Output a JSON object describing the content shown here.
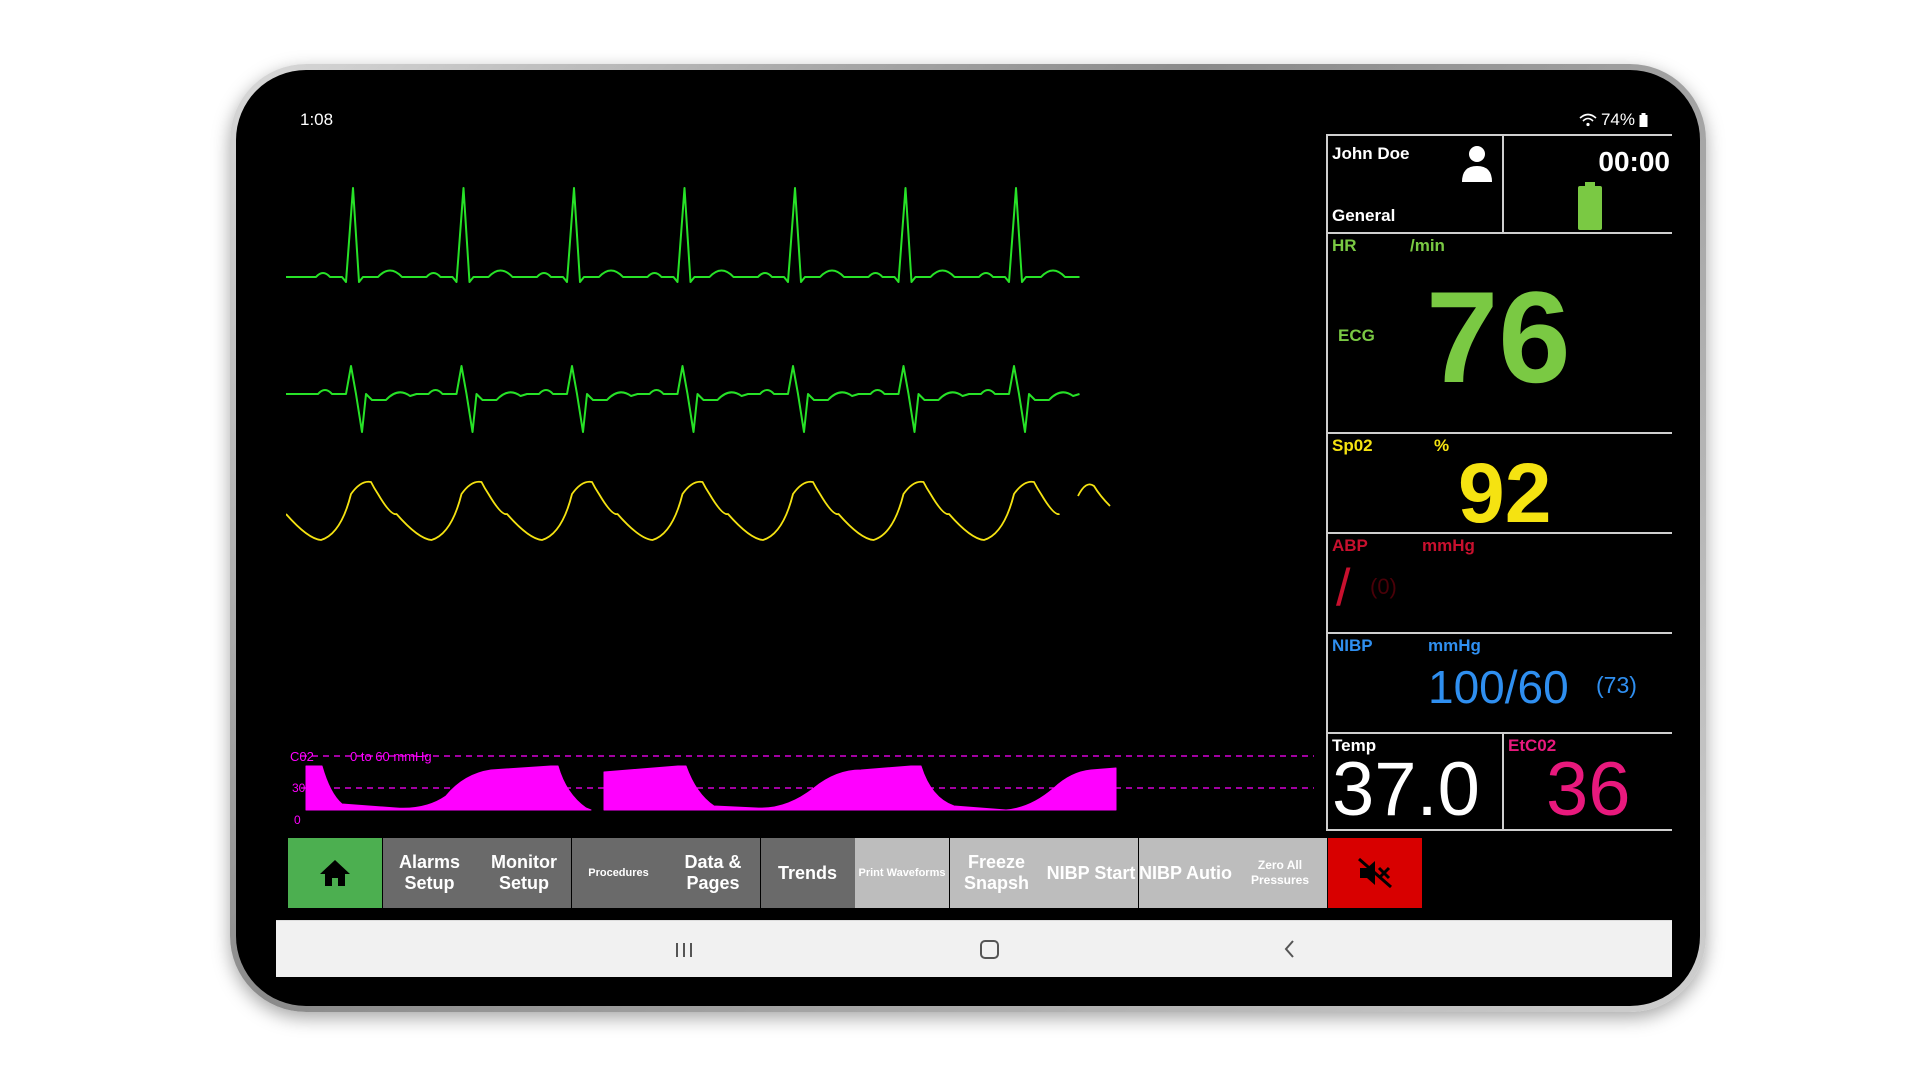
{
  "status": {
    "time": "1:08",
    "battery": "74%"
  },
  "patient": {
    "name": "John Doe",
    "category": "General",
    "timer": "00:00"
  },
  "hr": {
    "label": "HR",
    "unit": "/min",
    "source": "ECG",
    "value": "76"
  },
  "spo2": {
    "label": "Sp02",
    "unit": "%",
    "value": "92"
  },
  "abp": {
    "label": "ABP",
    "unit": "mmHg",
    "slash": "/",
    "mean": "(0)"
  },
  "nibp": {
    "label": "NIBP",
    "unit": "mmHg",
    "value": "100/60",
    "mean": "(73)"
  },
  "temp": {
    "label": "Temp",
    "value": "37.0"
  },
  "etco2": {
    "label": "EtC02",
    "value": "36"
  },
  "capno": {
    "label": "C02",
    "range": "0 to 60 mmHg",
    "scale_mid": "30",
    "scale_low": "0"
  },
  "buttons": [
    {
      "label": "",
      "icon": "home-icon",
      "color": "#4caf50"
    },
    {
      "label": "Alarms Setup",
      "color": "#6a6a6a"
    },
    {
      "label": "Monitor Setup",
      "color": "#6a6a6a"
    },
    {
      "label": "Procedures",
      "color": "#6a6a6a"
    },
    {
      "label": "Data & Pages",
      "color": "#6a6a6a"
    },
    {
      "label": "Trends",
      "color": "#6a6a6a"
    },
    {
      "label": "Print Waveforms",
      "color": "#bdbdbd"
    },
    {
      "label": "Freeze Snapsh",
      "color": "#bdbdbd"
    },
    {
      "label": "NIBP Start",
      "color": "#bdbdbd"
    },
    {
      "label": "NIBP Autio",
      "color": "#bdbdbd"
    },
    {
      "label": "Zero All Pressures",
      "color": "#bdbdbd"
    },
    {
      "label": "",
      "icon": "mute-icon",
      "color": "#d80000"
    }
  ],
  "colors": {
    "ecg": "#27e227",
    "hr": "#7ac943",
    "spo2": "#f5e311",
    "abp": "#c8102e",
    "nibp": "#2f8ff0",
    "etco2": "#e8197d",
    "capno": "#ff00ff"
  }
}
